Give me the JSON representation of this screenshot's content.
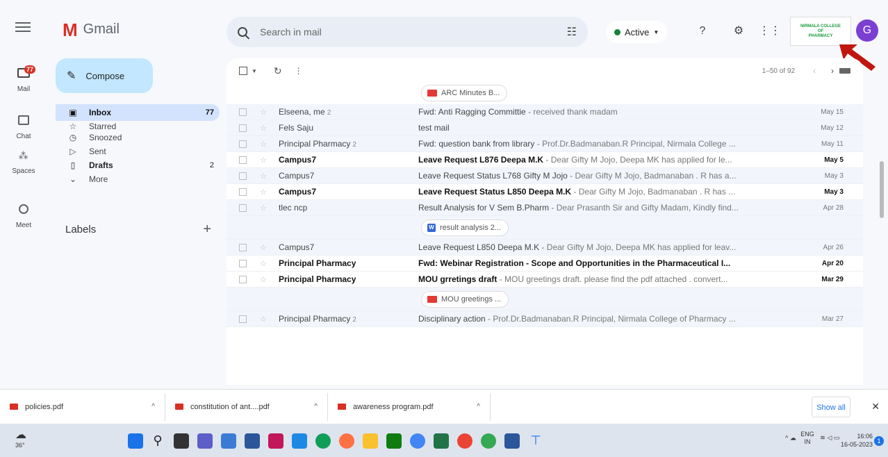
{
  "app": {
    "name": "Gmail"
  },
  "rail": [
    {
      "label": "Mail",
      "badge": "77"
    },
    {
      "label": "Chat"
    },
    {
      "label": "Spaces"
    },
    {
      "label": "Meet"
    }
  ],
  "header": {
    "search_placeholder": "Search in mail",
    "status": "Active",
    "college_logo_text": [
      "NIRMALA COLLEGE",
      "OF",
      "PHARMACY"
    ],
    "avatar_initial": "G"
  },
  "compose_label": "Compose",
  "nav": [
    {
      "label": "Inbox",
      "count": "77",
      "icon": "inbox-icon"
    },
    {
      "label": "Starred",
      "icon": "star-icon"
    },
    {
      "label": "Snoozed",
      "icon": "clock-icon"
    },
    {
      "label": "Sent",
      "icon": "send-icon"
    },
    {
      "label": "Drafts",
      "count": "2",
      "icon": "draft-icon"
    },
    {
      "label": "More",
      "icon": "chevron-down-icon"
    }
  ],
  "labels_title": "Labels",
  "toolbar": {
    "range": "1–50 of 92"
  },
  "top_attachment": "ARC Minutes B...",
  "emails": [
    {
      "sender": "Elseena, me",
      "num": "2",
      "subject": "Fwd: Anti Ragging Committie",
      "snippet": " - received thank madam",
      "date": "May 15",
      "unread": false
    },
    {
      "sender": "Fels Saju",
      "num": "",
      "subject": "test mail",
      "snippet": "",
      "date": "May 12",
      "unread": false
    },
    {
      "sender": "Principal Pharmacy",
      "num": "2",
      "subject": "Fwd: question bank from library",
      "snippet": " - Prof.Dr.Badmanaban.R Principal, Nirmala College ...",
      "date": "May 11",
      "unread": false
    },
    {
      "sender": "Campus7",
      "num": "",
      "subject": "Leave Request L876 Deepa M.K",
      "snippet": " - Dear Gifty M Jojo, Deepa MK has applied for le...",
      "date": "May 5",
      "unread": true
    },
    {
      "sender": "Campus7",
      "num": "",
      "subject": "Leave Request Status L768 Gifty M Jojo",
      "snippet": " - Dear Gifty M Jojo, Badmanaban . R has a...",
      "date": "May 3",
      "unread": false
    },
    {
      "sender": "Campus7",
      "num": "",
      "subject": "Leave Request Status L850 Deepa M.K",
      "snippet": " - Dear Gifty M Jojo, Badmanaban . R has ...",
      "date": "May 3",
      "unread": true
    },
    {
      "sender": "tlec ncp",
      "num": "",
      "subject": "Result Analysis for V Sem B.Pharm",
      "snippet": " - Dear Prasanth Sir and Gifty Madam, Kindly find...",
      "date": "Apr 28",
      "unread": false,
      "attachment": "result analysis 2...",
      "attach_type": "word"
    },
    {
      "sender": "Campus7",
      "num": "",
      "subject": "Leave Request L850 Deepa M.K",
      "snippet": " - Dear Gifty M Jojo, Deepa MK has applied for leav...",
      "date": "Apr 26",
      "unread": false
    },
    {
      "sender": "Principal Pharmacy",
      "num": "",
      "subject": "Fwd: Webinar Registration - Scope and Opportunities in the Pharmaceutical I...",
      "snippet": "",
      "date": "Apr 20",
      "unread": true
    },
    {
      "sender": "Principal Pharmacy",
      "num": "",
      "subject": "MOU grretings draft",
      "snippet": " - MOU greetings draft. please find the pdf attached . convert...",
      "date": "Mar 29",
      "unread": true,
      "attachment": "MOU greetings ...",
      "attach_type": "pdf"
    },
    {
      "sender": "Principal Pharmacy",
      "num": "2",
      "subject": "Disciplinary action",
      "snippet": " - Prof.Dr.Badmanaban.R Principal, Nirmala College of Pharmacy ...",
      "date": "Mar 27",
      "unread": false
    }
  ],
  "downloads": [
    {
      "name": "policies.pdf"
    },
    {
      "name": "constitution of ant....pdf"
    },
    {
      "name": "awareness program.pdf"
    }
  ],
  "show_all": "Show all",
  "taskbar": {
    "weather": "36°",
    "lang": "ENG",
    "region": "IN",
    "time": "16:06",
    "date": "16-05-2023",
    "notifications": "1"
  }
}
